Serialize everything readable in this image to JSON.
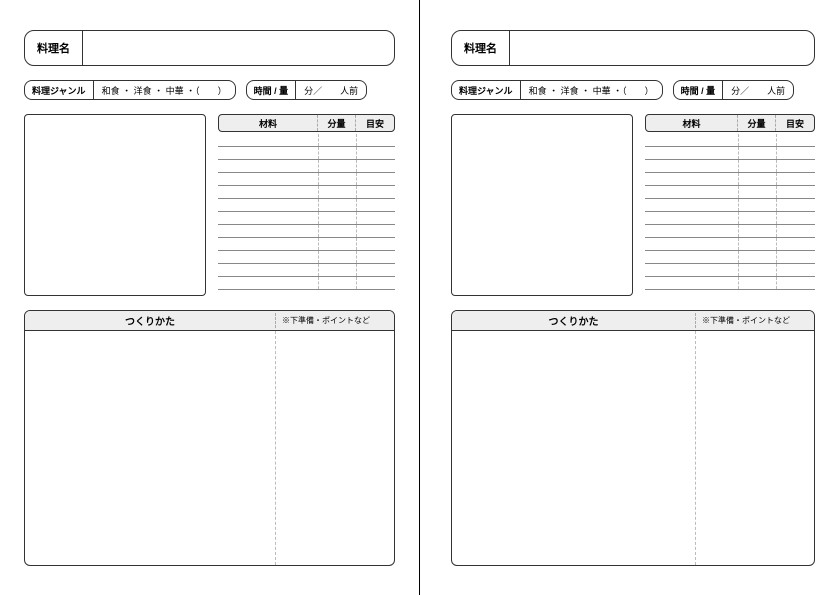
{
  "labels": {
    "recipe_name": "料理名",
    "genre": "料理ジャンル",
    "genre_options": "和食 ・ 洋食 ・ 中華 ・（　　）",
    "time_amount": "時間 / 量",
    "time_value": "分／　　人前",
    "ingredient": "材料",
    "portion": "分量",
    "guide": "目安",
    "howto": "つくりかた",
    "howto_sub": "※下準備・ポイントなど"
  },
  "ingredient_rows": 12
}
